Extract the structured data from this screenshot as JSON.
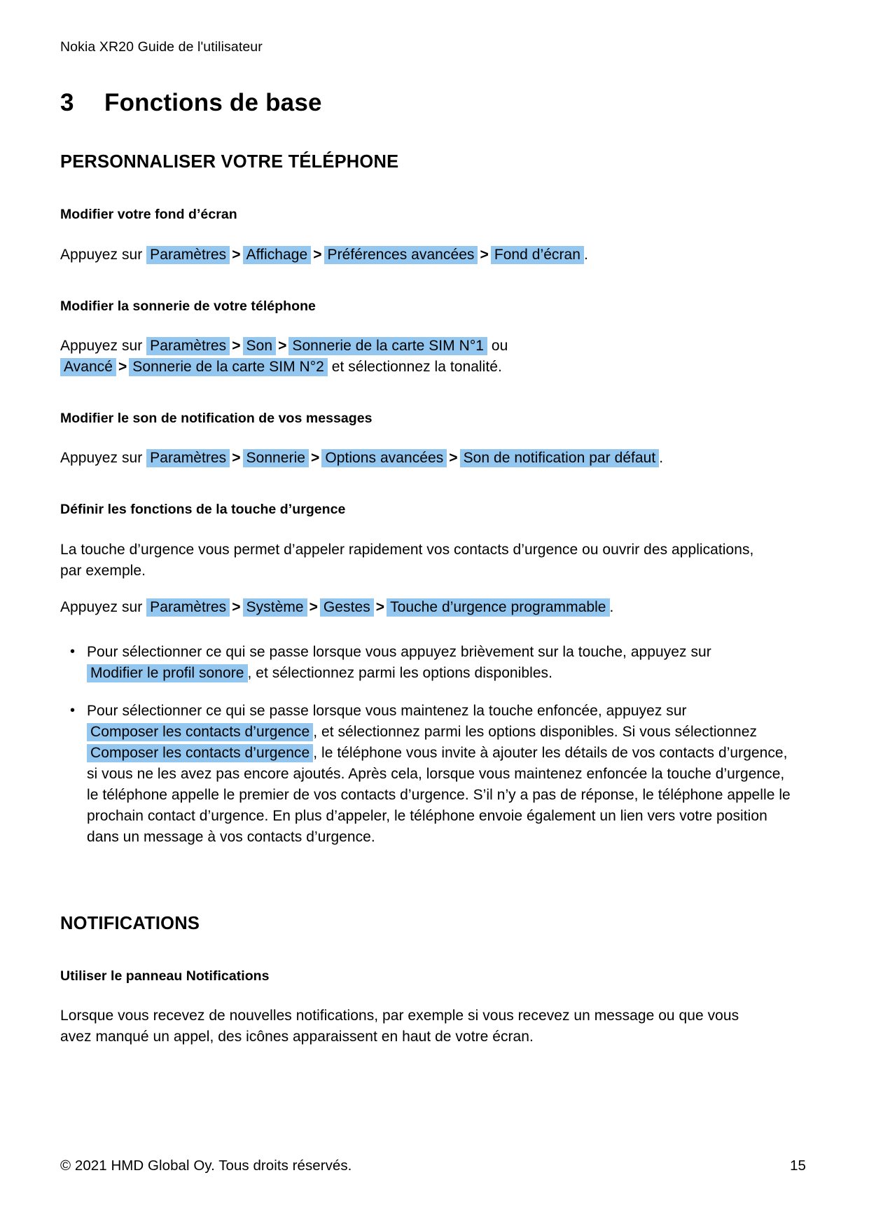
{
  "document": {
    "running_header": "Nokia XR20 Guide de l'utilisateur",
    "chapter_number": "3",
    "chapter_title": "Fonctions de base"
  },
  "sections": {
    "personalize": {
      "heading": "PERSONNALISER VOTRE TÉLÉPHONE",
      "wallpaper": {
        "heading": "Modifier votre fond d’écran",
        "lead": "Appuyez sur",
        "path": [
          "Paramètres",
          "Affichage",
          "Préférences avancées",
          "Fond d’écran"
        ],
        "separator": ">",
        "trailing": "."
      },
      "ringtone": {
        "heading": "Modifier la sonnerie de votre téléphone",
        "lead": "Appuyez sur",
        "path_1": [
          "Paramètres",
          "Son",
          "Sonnerie de la carte SIM N°1"
        ],
        "separator": ">",
        "conjunction": "ou",
        "advanced_chip": "Avancé",
        "sim2_chip": "Sonnerie de la carte SIM N°2",
        "trailing": "et sélectionnez la tonalité."
      },
      "notification_sound": {
        "heading": "Modifier le son de notification de vos messages",
        "lead": "Appuyez sur",
        "path": [
          "Paramètres",
          "Sonnerie",
          "Options avancées",
          "Son de notification par défaut"
        ],
        "separator": ">",
        "trailing": "."
      },
      "emergency_key": {
        "heading": "Définir les fonctions de la touche d’urgence",
        "intro": "La touche d’urgence vous permet d’appeler rapidement vos contacts d’urgence ou ouvrir des applications, par exemple.",
        "lead": "Appuyez sur",
        "path": [
          "Paramètres",
          "Système",
          "Gestes",
          "Touche d’urgence programmable"
        ],
        "separator": ">",
        "trailing": ".",
        "bullets": {
          "short_press": {
            "text_before": "Pour sélectionner ce qui se passe lorsque vous appuyez brièvement sur la touche, appuyez sur",
            "chip": "Modifier le profil sonore",
            "text_after": ", et sélectionnez parmi les options disponibles."
          },
          "long_press": {
            "text_before": "Pour sélectionner ce qui se passe lorsque vous maintenez la touche enfoncée, appuyez sur",
            "chip_1": "Composer les contacts d’urgence",
            "text_middle_1": ", et sélectionnez parmi les options disponibles. Si vous sélectionnez",
            "chip_2": "Composer les contacts d’urgence",
            "text_after": ", le téléphone vous invite à ajouter les détails de vos contacts d’urgence, si vous ne les avez pas encore ajoutés. Après cela, lorsque vous maintenez enfoncée la touche d’urgence, le téléphone appelle le premier de vos contacts d’urgence. S’il n’y a pas de réponse, le téléphone appelle le prochain contact d’urgence. En plus d’appeler, le téléphone envoie également un lien vers votre position dans un message à vos contacts d’urgence."
          }
        }
      }
    },
    "notifications": {
      "heading": "NOTIFICATIONS",
      "panel": {
        "heading": "Utiliser le panneau Notifications",
        "body": "Lorsque vous recevez de nouvelles notifications, par exemple si vous recevez un message ou que vous avez manqué un appel, des icônes apparaissent en haut de votre écran."
      }
    }
  },
  "footer": {
    "copyright": "© 2021 HMD Global Oy. Tous droits réservés.",
    "page_number": "15"
  },
  "colors": {
    "highlight": "#93c7f0",
    "text": "#000000",
    "background": "#ffffff"
  }
}
